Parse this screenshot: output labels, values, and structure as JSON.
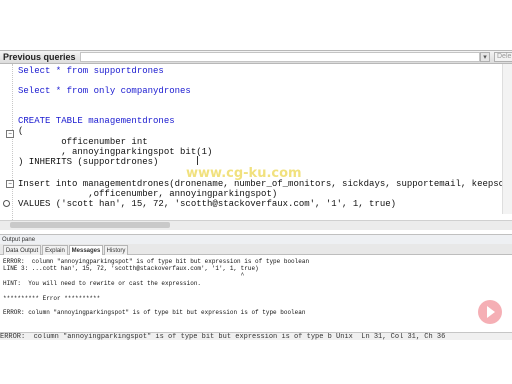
{
  "previous_queries": {
    "label": "Previous queries",
    "arrow": "▾",
    "delete_label": "Dele"
  },
  "editor": {
    "lines": [
      {
        "text": "Select * from supportdrones"
      },
      {
        "text": ""
      },
      {
        "text": "Select * from only companydrones"
      },
      {
        "text": ""
      },
      {
        "text": ""
      },
      {
        "text": "CREATE TABLE managementdrones"
      },
      {
        "text": "("
      },
      {
        "text": "        officenumber int"
      },
      {
        "text": "        , annoyingparkingspot bit(1)"
      },
      {
        "text": ") INHERITS (supportdrones)"
      },
      {
        "text": ""
      },
      {
        "text": "Insert into managementdrones(dronename, number_of_monitors, sickdays, supportemail, keepscool"
      },
      {
        "text": "             ,officenumber, annoyingparkingspot)"
      },
      {
        "text": "VALUES ('scott han', 15, 72, 'scotth@stackoverfaux.com', '1', 1, true)"
      }
    ],
    "watermark": "www.cg-ku.com"
  },
  "output_pane": {
    "title": "Output pane",
    "tabs": [
      "Data Output",
      "Explain",
      "Messages",
      "History"
    ],
    "active_tab": "Messages",
    "messages": [
      "ERROR:  column \"annoyingparkingspot\" is of type bit but expression is of type boolean",
      "LINE 3: ...cott han', 15, 72, 'scotth@stackoverfaux.com', '1', 1, true)",
      "                                                                  ^",
      "HINT:  You will need to rewrite or cast the expression.",
      "",
      "********** Error **********",
      "",
      "ERROR: column \"annoyingparkingspot\" is of type bit but expression is of type boolean"
    ]
  },
  "status_bar": {
    "text": "ERROR:  column \"annoyingparkingspot\" is of type bit but expression is of type b Unix  Ln 31, Col 31, Ch 36"
  }
}
